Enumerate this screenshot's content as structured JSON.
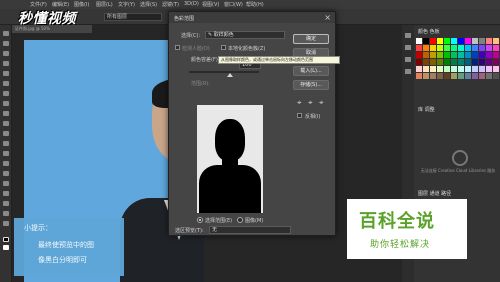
{
  "watermark": "秒懂视频",
  "menubar": {
    "items": [
      "文件(F)",
      "编辑(E)",
      "图像(I)",
      "图层(L)",
      "文字(Y)",
      "选择(S)",
      "滤镜(T)",
      "3D(D)",
      "视图(V)",
      "窗口(W)",
      "帮助(H)"
    ]
  },
  "options_bar": {
    "sample_label": "取样大小:",
    "sample_value": "取样点",
    "sample_target": "所有图层"
  },
  "document_tab": "证件照.jpg @ 50%",
  "hint": {
    "title": "小提示：",
    "line1": "最终使预览中的图",
    "line2": "像黑白分明即可"
  },
  "dialog": {
    "title": "色彩范围",
    "select_label": "选择(C):",
    "select_value": "取样颜色",
    "detect_faces": "检测人脸(D)",
    "localized_clusters": "本地化颜色簇(Z)",
    "fuzziness_label": "颜色容差(F):",
    "fuzziness_value": "100",
    "range_label": "范围(R):",
    "radio_selection": "选择范围(E)",
    "radio_image": "图像(M)",
    "preview_label": "选区预览(T):",
    "preview_value": "无",
    "tooltip": "从图像取样颜色，或通过单击鼠标向左移动颜色范围",
    "buttons": {
      "ok": "确定",
      "cancel": "取消",
      "load": "载入(L)...",
      "save": "存储(S)..."
    },
    "invert": "反相(I)"
  },
  "panels": {
    "swatch_tabs": "颜色  色板",
    "swatch_colors": [
      "#ffffff",
      "#000000",
      "#ff0000",
      "#ffff00",
      "#00ff00",
      "#00ffff",
      "#0000ff",
      "#ff00ff",
      "#c0c0c0",
      "#808080",
      "#ff8080",
      "#ffc080",
      "#ff4040",
      "#ff8000",
      "#ffd000",
      "#c0ff00",
      "#40ff40",
      "#00ff80",
      "#00ffd0",
      "#00c0ff",
      "#4080ff",
      "#8040ff",
      "#d040ff",
      "#ff40c0",
      "#c00000",
      "#c06000",
      "#c0a000",
      "#80c000",
      "#00c000",
      "#00c060",
      "#00c0a0",
      "#0090c0",
      "#0040c0",
      "#4000c0",
      "#9000c0",
      "#c00090",
      "#800000",
      "#804000",
      "#806000",
      "#608000",
      "#008000",
      "#008040",
      "#008070",
      "#006080",
      "#002080",
      "#300080",
      "#600080",
      "#800060",
      "#ffd0d0",
      "#ffe0c0",
      "#fff0c0",
      "#e0ffc0",
      "#c0ffc0",
      "#c0ffe0",
      "#c0fff0",
      "#c0f0ff",
      "#c0d0ff",
      "#d0c0ff",
      "#f0c0ff",
      "#ffc0f0",
      "#e08060",
      "#c09060",
      "#a08060",
      "#806040",
      "#604020",
      "#a0a060",
      "#60a080",
      "#6080a0",
      "#8060a0",
      "#a06080",
      "#707070",
      "#505050"
    ],
    "library_tabs": "库  调整",
    "library_text": "无法连接 Creative Cloud Libraries 服务",
    "layers_tabs": "图层  通道  路径"
  },
  "logo": {
    "title": "百科全说",
    "subtitle": "助你轻松解决"
  }
}
